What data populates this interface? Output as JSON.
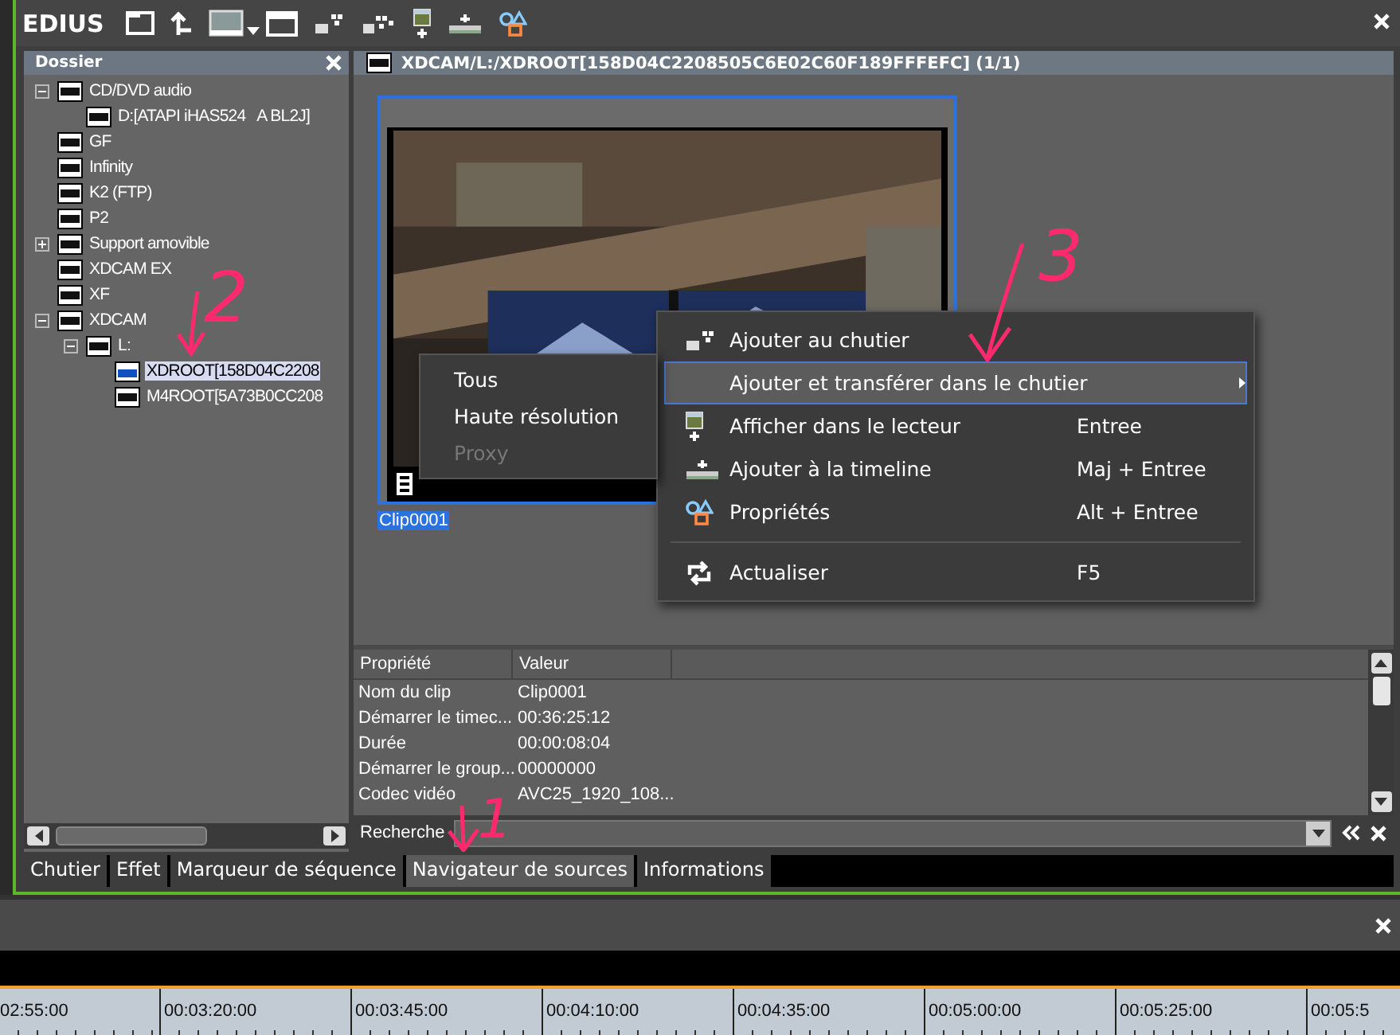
{
  "app": {
    "logo": "EDIUS"
  },
  "folder_panel": {
    "title": "Dossier",
    "tree": [
      {
        "label": "CD/DVD audio",
        "expanded": true,
        "selected": false,
        "children": [
          {
            "label": "D:[ATAPI iHAS524   A BL2J]",
            "selected": false
          }
        ]
      },
      {
        "label": "GF",
        "selected": false
      },
      {
        "label": "Infinity",
        "selected": false
      },
      {
        "label": "K2 (FTP)",
        "selected": false
      },
      {
        "label": "P2",
        "selected": false
      },
      {
        "label": "Support amovible",
        "expanded": false,
        "selected": false
      },
      {
        "label": "XDCAM EX",
        "selected": false
      },
      {
        "label": "XF",
        "selected": false
      },
      {
        "label": "XDCAM",
        "expanded": true,
        "selected": false,
        "children": [
          {
            "label": "L:",
            "expanded": true,
            "selected": false,
            "children": [
              {
                "label": "XDROOT[158D04C2208",
                "selected": true
              },
              {
                "label": "M4ROOT[5A73B0CC208",
                "selected": false
              }
            ]
          }
        ]
      }
    ]
  },
  "source_panel": {
    "path": "XDCAM/L:/XDROOT[158D04C2208505C6E02C60F189FFFEFC] (1/1)",
    "clips": [
      {
        "name": "Clip0001",
        "selected": true,
        "kind": "picture"
      }
    ]
  },
  "properties": {
    "columns": [
      "Propriété",
      "Valeur"
    ],
    "rows": [
      {
        "property": "Nom du clip",
        "value": "Clip0001"
      },
      {
        "property": "Démarrer le timec...",
        "value": "00:36:25:12"
      },
      {
        "property": "Durée",
        "value": "00:00:08:04"
      },
      {
        "property": "Démarrer le group...",
        "value": "00000000"
      },
      {
        "property": "Codec vidéo",
        "value": "AVC25_1920_108..."
      }
    ]
  },
  "search": {
    "label": "Recherche"
  },
  "tabs": [
    {
      "label": "Chutier",
      "selected": false
    },
    {
      "label": "Effet",
      "selected": false
    },
    {
      "label": "Marqueur de séquence",
      "selected": false
    },
    {
      "label": "Navigateur de sources",
      "selected": true
    },
    {
      "label": "Informations",
      "selected": false
    }
  ],
  "context_menu": {
    "items": [
      {
        "kind": "item",
        "label": "Ajouter au chutier",
        "highlighted": false
      },
      {
        "kind": "submenu",
        "label": "Ajouter et transférer dans le chutier",
        "highlighted": true
      },
      {
        "kind": "item",
        "label": "Afficher dans le lecteur",
        "shortcut": "Entree",
        "highlighted": false
      },
      {
        "kind": "item",
        "label": "Ajouter à la timeline",
        "shortcut": "Maj + Entree",
        "highlighted": false
      },
      {
        "kind": "item",
        "label": "Propriétés",
        "shortcut": "Alt + Entree",
        "highlighted": false
      },
      {
        "kind": "separator"
      },
      {
        "kind": "item",
        "label": "Actualiser",
        "shortcut": "F5",
        "highlighted": false
      }
    ]
  },
  "submenu": {
    "items": [
      {
        "label": "Tous",
        "disabled": false
      },
      {
        "label": "Haute résolution",
        "disabled": false
      },
      {
        "label": "Proxy",
        "disabled": true
      }
    ]
  },
  "timeline": {
    "ticks": [
      "02:55:00",
      "00:03:20:00",
      "00:03:45:00",
      "00:04:10:00",
      "00:04:35:00",
      "00:05:00:00",
      "00:05:25:00",
      "00:05:5"
    ]
  },
  "annotations": [
    {
      "label": "2"
    },
    {
      "label": "3"
    },
    {
      "label": "1"
    }
  ]
}
